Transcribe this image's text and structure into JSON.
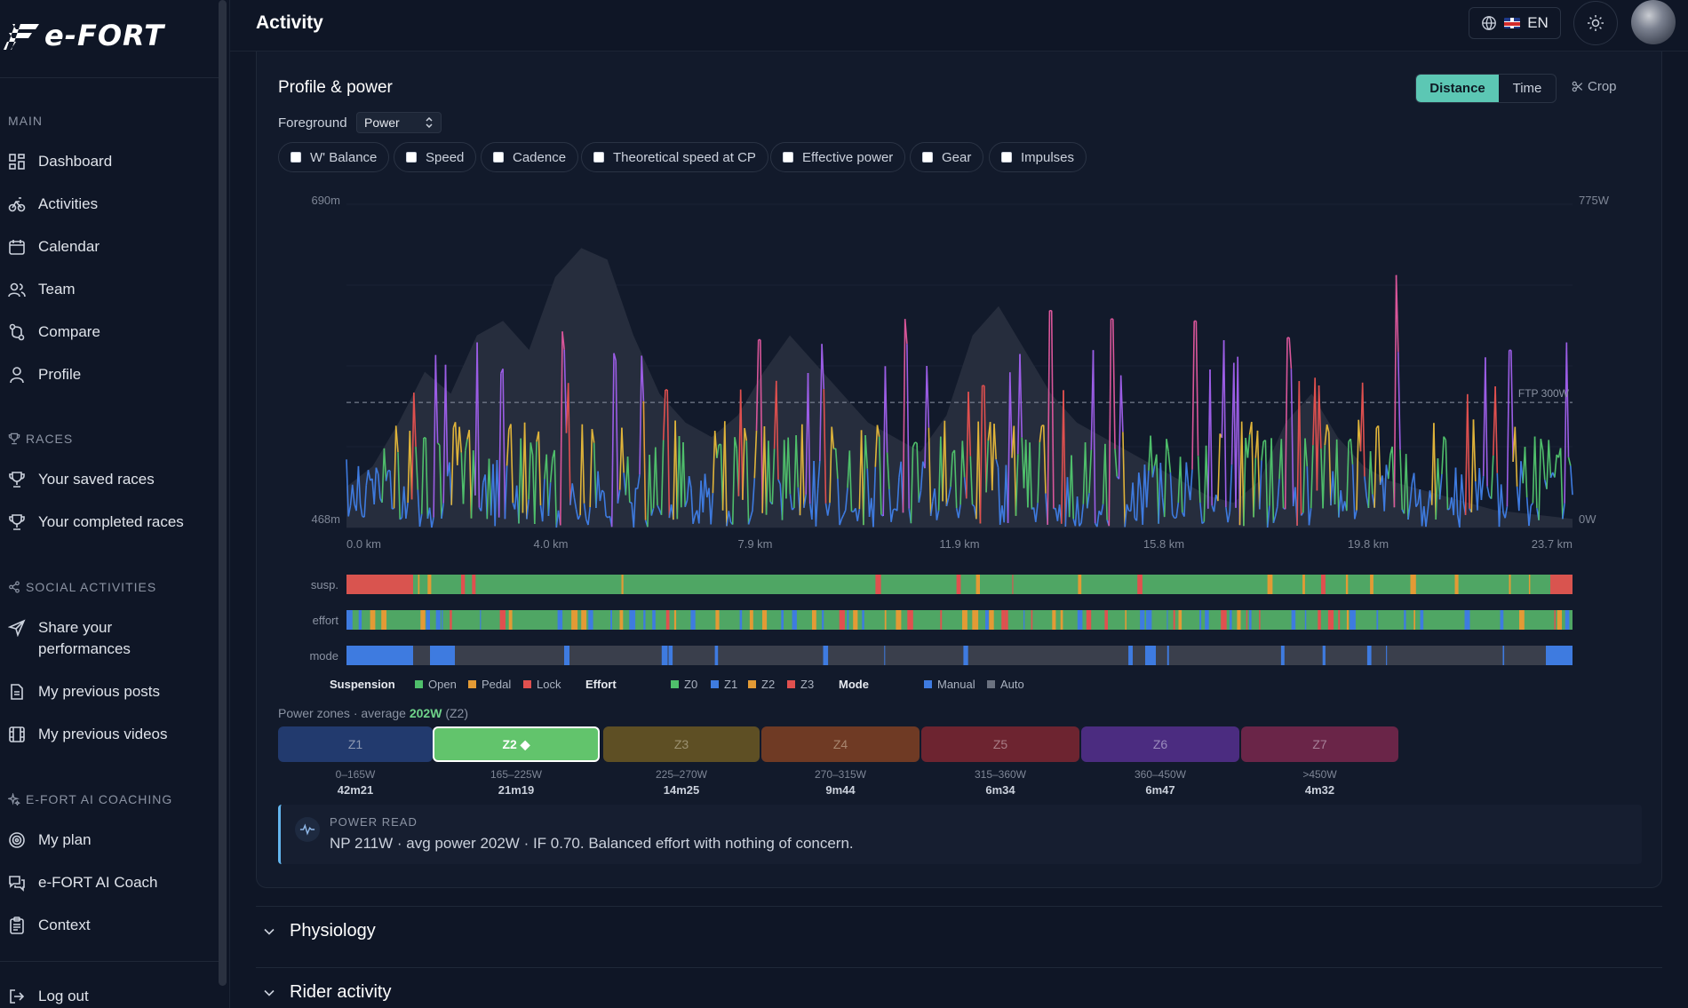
{
  "app": {
    "logo_text": "e-FORT"
  },
  "sidebar": {
    "main_title": "MAIN",
    "main_items": [
      {
        "label": "Dashboard",
        "icon": "grid-icon"
      },
      {
        "label": "Activities",
        "icon": "bike-icon"
      },
      {
        "label": "Calendar",
        "icon": "calendar-icon"
      },
      {
        "label": "Team",
        "icon": "team-icon"
      },
      {
        "label": "Compare",
        "icon": "compare-icon"
      },
      {
        "label": "Profile",
        "icon": "user-icon"
      }
    ],
    "races_title": "RACES",
    "races_items": [
      {
        "label": "Your saved races",
        "icon": "trophy-icon"
      },
      {
        "label": "Your completed races",
        "icon": "trophy-icon"
      }
    ],
    "social_title": "SOCIAL ACTIVITIES",
    "social_items": [
      {
        "label": "Share your performances",
        "icon": "send-icon"
      },
      {
        "label": "My previous posts",
        "icon": "document-icon"
      },
      {
        "label": "My previous videos",
        "icon": "film-icon"
      }
    ],
    "coaching_title": "E-FORT AI COACHING",
    "coaching_items": [
      {
        "label": "My plan",
        "icon": "target-icon"
      },
      {
        "label": "e-FORT AI Coach",
        "icon": "chat-icon"
      },
      {
        "label": "Context",
        "icon": "clipboard-icon"
      }
    ],
    "logout_label": "Log out"
  },
  "topbar": {
    "title": "Activity",
    "language": "EN"
  },
  "card": {
    "title": "Profile & power",
    "toggle_distance": "Distance",
    "toggle_time": "Time",
    "crop_label": "Crop",
    "foreground_label": "Foreground",
    "foreground_value": "Power",
    "overlays": [
      "W' Balance",
      "Speed",
      "Cadence",
      "Theoretical speed at CP",
      "Effective power",
      "Gear",
      "Impulses"
    ],
    "power_zones_prefix": "Power zones · average ",
    "power_zones_avg": "202W",
    "power_zones_suffix": " (Z2)",
    "power_read_title": "POWER READ",
    "power_read_text": "NP 211W · avg power 202W · IF 0.70. Balanced effort with nothing of concern."
  },
  "zones": [
    {
      "name": "Z1",
      "range": "0–165W",
      "time": "42m21",
      "color": "#223a6e",
      "text": "#8f9ab2"
    },
    {
      "name": "Z2 ◆",
      "range": "165–225W",
      "time": "21m19",
      "color": "#62c46c",
      "text": "#ffffff"
    },
    {
      "name": "Z3",
      "range": "225–270W",
      "time": "14m25",
      "color": "#5e4f24",
      "text": "#9c9170"
    },
    {
      "name": "Z4",
      "range": "270–315W",
      "time": "9m44",
      "color": "#6f3a24",
      "text": "#a8866f"
    },
    {
      "name": "Z5",
      "range": "315–360W",
      "time": "6m34",
      "color": "#6d2430",
      "text": "#a97d86"
    },
    {
      "name": "Z6",
      "range": "360–450W",
      "time": "6m47",
      "color": "#4b2c80",
      "text": "#9b8cbd"
    },
    {
      "name": "Z7",
      "range": ">450W",
      "time": "4m32",
      "color": "#6a2548",
      "text": "#a77f97"
    }
  ],
  "legend": {
    "suspension_title": "Suspension",
    "suspension_items": [
      {
        "label": "Open",
        "color": "#4fbf6b"
      },
      {
        "label": "Pedal",
        "color": "#e39a35"
      },
      {
        "label": "Lock",
        "color": "#e0504f"
      }
    ],
    "effort_title": "Effort",
    "effort_items": [
      {
        "label": "Z0",
        "color": "#4fbf6b"
      },
      {
        "label": "Z1",
        "color": "#3e7be0"
      },
      {
        "label": "Z2",
        "color": "#e39a35"
      },
      {
        "label": "Z3",
        "color": "#e0504f"
      }
    ],
    "mode_title": "Mode",
    "mode_items": [
      {
        "label": "Manual",
        "color": "#3e7be0"
      },
      {
        "label": "Auto",
        "color": "#6b7280"
      }
    ]
  },
  "bars": {
    "susp_label": "susp.",
    "effort_label": "effort",
    "mode_label": "mode"
  },
  "chart_data": {
    "type": "line",
    "title": "",
    "x_ticks": [
      "0.0 km",
      "4.0 km",
      "7.9 km",
      "11.9 km",
      "15.8 km",
      "19.8 km",
      "23.7 km"
    ],
    "x_range_km": [
      0,
      23.7
    ],
    "y_left_ticks": [
      "690m",
      "468m"
    ],
    "y_left_range_m": [
      468,
      690
    ],
    "y_right_ticks": [
      "775W",
      "0W"
    ],
    "y_right_range_w": [
      0,
      775
    ],
    "ftp_label": "FTP 300W",
    "ftp_w": 300,
    "series": [
      {
        "kind": "elevation-area",
        "color": "#2a3142"
      },
      {
        "kind": "power",
        "color_by": "power zone"
      }
    ],
    "elevation_m": [
      496,
      510,
      540,
      575,
      560,
      600,
      610,
      590,
      640,
      660,
      652,
      600,
      560,
      540,
      530,
      545,
      575,
      600,
      580,
      560,
      540,
      530,
      520,
      545,
      600,
      620,
      590,
      560,
      540,
      530,
      520,
      510,
      500,
      490,
      485,
      500,
      540,
      560,
      530,
      510,
      500,
      495,
      490,
      485,
      480,
      478,
      476,
      474
    ],
    "power_peaks": [
      {
        "km": 1.5,
        "w": 215
      },
      {
        "km": 3.0,
        "w": 370
      },
      {
        "km": 4.2,
        "w": 470
      },
      {
        "km": 5.2,
        "w": 400
      },
      {
        "km": 6.2,
        "w": 330
      },
      {
        "km": 8.0,
        "w": 450
      },
      {
        "km": 9.2,
        "w": 440
      },
      {
        "km": 10.8,
        "w": 500
      },
      {
        "km": 12.3,
        "w": 340
      },
      {
        "km": 13.6,
        "w": 520
      },
      {
        "km": 14.8,
        "w": 500
      },
      {
        "km": 16.4,
        "w": 495
      },
      {
        "km": 18.2,
        "w": 455
      },
      {
        "km": 20.3,
        "w": 605
      },
      {
        "km": 22.5,
        "w": 425
      }
    ]
  }
}
